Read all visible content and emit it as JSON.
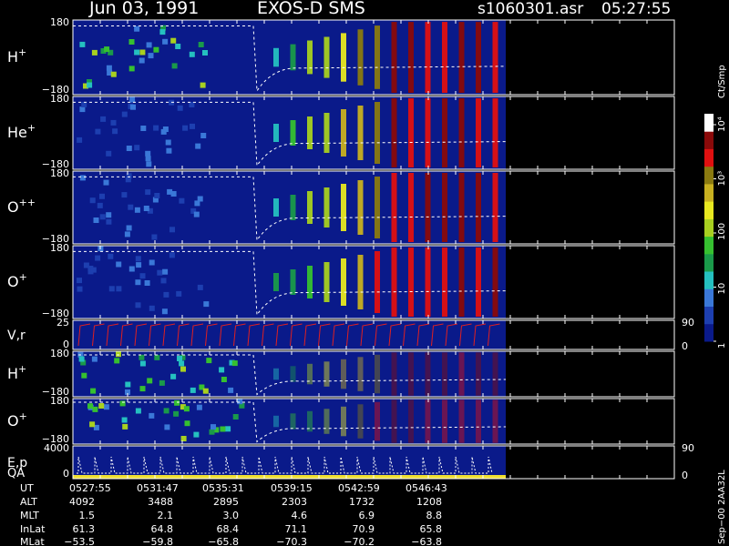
{
  "header": {
    "date": "Jun 03, 1991",
    "instrument": "EXOS-D SMS",
    "filename": "s1060301.asr",
    "time": "05:27:55"
  },
  "colorbar": {
    "unit_label": "Ct/Smp",
    "tick_labels": [
      "1",
      "10",
      "100",
      "10³",
      "10⁴"
    ],
    "tick_values": [
      1,
      10,
      100,
      1000,
      10000
    ],
    "colors": [
      "#0a1a8a",
      "#1d3fb0",
      "#3a78d8",
      "#25c0c0",
      "#1a9a4a",
      "#36c030",
      "#a8d020",
      "#e8e820",
      "#c8b020",
      "#8a7a10",
      "#e01010",
      "#8a0a0a",
      "#ffffff"
    ]
  },
  "panels": [
    {
      "label": "H",
      "sup": "+",
      "ymax": "180",
      "ymin": "−180"
    },
    {
      "label": "He",
      "sup": "+",
      "ymax": "180",
      "ymin": "−180"
    },
    {
      "label": "O",
      "sup": "++",
      "ymax": "180",
      "ymin": "−180"
    },
    {
      "label": "O",
      "sup": "+",
      "ymax": "180",
      "ymin": "−180"
    },
    {
      "label": "V,r",
      "sup": "",
      "ymax": "25",
      "ymin": "0",
      "right_top": "90",
      "right_bottom": "0"
    },
    {
      "label": "H",
      "sup": "+",
      "ymax": "180",
      "ymin": "−180"
    },
    {
      "label": "O",
      "sup": "+",
      "ymax": "180",
      "ymin": "−180"
    },
    {
      "label": "E,p",
      "label2": "QA",
      "sup": "",
      "ymax": "4000",
      "ymin": "0",
      "right_top": "90",
      "right_bottom": "0"
    }
  ],
  "ephemeris": {
    "row_labels": [
      "UT",
      "ALT",
      "MLT",
      "InLat",
      "MLat"
    ],
    "columns": [
      [
        "0527:55",
        "4092",
        "1.5",
        "61.3",
        "−53.5"
      ],
      [
        "0531:47",
        "3488",
        "2.1",
        "64.8",
        "−59.8"
      ],
      [
        "0535:31",
        "2895",
        "3.0",
        "68.4",
        "−65.8"
      ],
      [
        "0539:15",
        "2303",
        "4.6",
        "71.1",
        "−70.3"
      ],
      [
        "0542:59",
        "1732",
        "6.9",
        "70.9",
        "−70.2"
      ],
      [
        "0546:43",
        "1208",
        "8.8",
        "65.8",
        "−63.8"
      ]
    ]
  },
  "side_note": "Sep−00 2AA32L",
  "chart_data": {
    "type": "heatmap",
    "title": "Jun 03, 1991   EXOS-D SMS",
    "x_tick_labels": [
      "0527:55",
      "0531:47",
      "0535:31",
      "0539:15",
      "0542:59",
      "0546:43"
    ],
    "color_scale": "log",
    "color_range": [
      1,
      10000
    ],
    "series": [
      {
        "name": "H+",
        "yrange": [
          -180,
          180
        ]
      },
      {
        "name": "He+",
        "yrange": [
          -180,
          180
        ]
      },
      {
        "name": "O++",
        "yrange": [
          -180,
          180
        ]
      },
      {
        "name": "O+",
        "yrange": [
          -180,
          180
        ]
      },
      {
        "name": "V,r",
        "yrange": [
          0,
          25
        ]
      },
      {
        "name": "H+",
        "yrange": [
          -180,
          180
        ]
      },
      {
        "name": "O+",
        "yrange": [
          -180,
          180
        ]
      },
      {
        "name": "E,p",
        "yrange": [
          0,
          4000
        ]
      }
    ]
  }
}
